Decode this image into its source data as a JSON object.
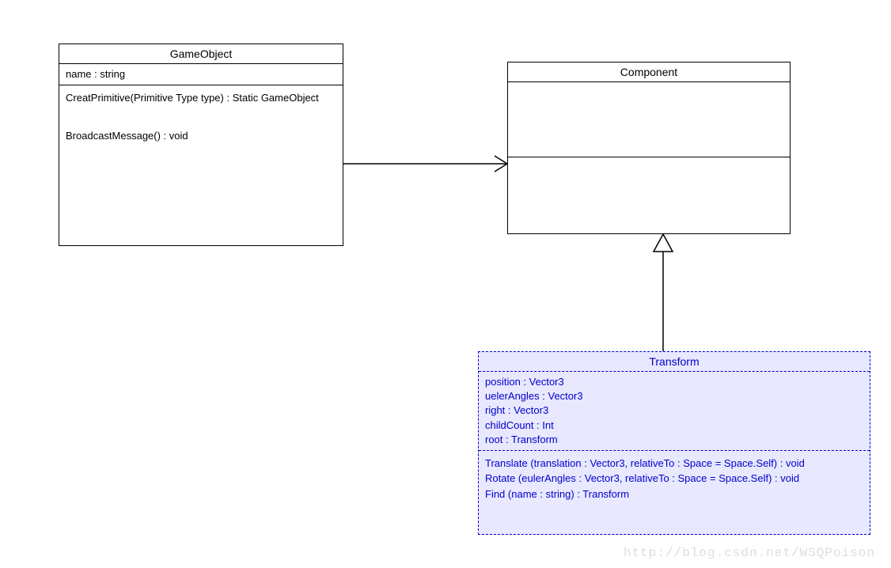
{
  "classes": {
    "gameObject": {
      "name": "GameObject",
      "attrs": [
        "name : string"
      ],
      "methods": [
        "CreatPrimitive(Primitive Type type) : Static GameObject",
        "BroadcastMessage() : void"
      ]
    },
    "component": {
      "name": "Component",
      "attrs": [],
      "methods": []
    },
    "transform": {
      "name": "Transform",
      "attrs": [
        "position : Vector3",
        "uelerAngles : Vector3",
        "right : Vector3",
        "childCount : Int",
        "root : Transform"
      ],
      "methods": [
        "Translate (translation : Vector3, relativeTo : Space = Space.Self) : void",
        "Rotate (eulerAngles : Vector3, relativeTo : Space = Space.Self) : void",
        "Find (name : string) : Transform"
      ]
    }
  },
  "watermark": "http://blog.csdn.net/WSQPoison",
  "chart_data": {
    "type": "uml-class-diagram",
    "nodes": [
      {
        "id": "GameObject",
        "attributes": [
          "name : string"
        ],
        "operations": [
          "CreatPrimitive(Primitive Type type) : Static GameObject",
          "BroadcastMessage() : void"
        ]
      },
      {
        "id": "Component",
        "attributes": [],
        "operations": []
      },
      {
        "id": "Transform",
        "attributes": [
          "position : Vector3",
          "uelerAngles : Vector3",
          "right : Vector3",
          "childCount : Int",
          "root : Transform"
        ],
        "operations": [
          "Translate (translation : Vector3, relativeTo : Space = Space.Self) : void",
          "Rotate (eulerAngles : Vector3, relativeTo : Space = Space.Self) : void",
          "Find (name : string) : Transform"
        ],
        "style": "dashed"
      }
    ],
    "edges": [
      {
        "from": "GameObject",
        "to": "Component",
        "kind": "association",
        "arrowhead": "open"
      },
      {
        "from": "Transform",
        "to": "Component",
        "kind": "generalization",
        "arrowhead": "hollow-triangle"
      }
    ]
  }
}
